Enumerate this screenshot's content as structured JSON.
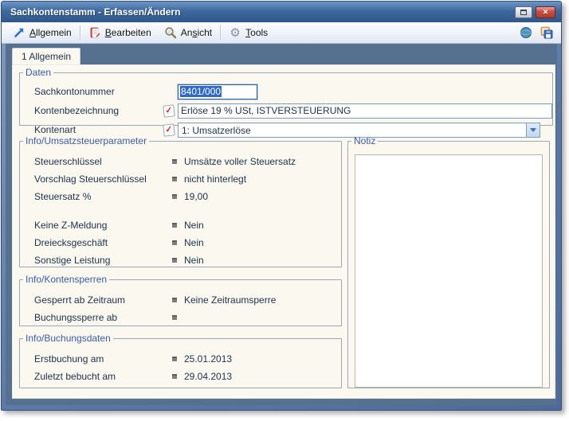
{
  "window": {
    "title": "Sachkontenstamm - Erfassen/Ändern",
    "controls": {
      "restore": "restore-window",
      "close_glyph": "✕"
    }
  },
  "toolbar": {
    "items": [
      {
        "label": "Allgemein",
        "mnemonic": "A",
        "icon": "arrow-up-right-icon"
      },
      {
        "label": "Bearbeiten",
        "mnemonic": "B",
        "icon": "notebook-icon"
      },
      {
        "label": "Ansicht",
        "mnemonic": "s",
        "icon": "magnifier-icon"
      },
      {
        "label": "Tools",
        "mnemonic": "T",
        "icon": "gears-icon"
      }
    ],
    "right_icons": [
      "globe-icon",
      "save-icon"
    ],
    "gear_glyph": "⚙"
  },
  "tab": {
    "label": "1 Allgemein"
  },
  "daten": {
    "legend": "Daten",
    "sachkontonummer": {
      "label": "Sachkontonummer",
      "value": "8401/000"
    },
    "kontenbezeichnung": {
      "label": "Kontenbezeichnung",
      "value": "Erlöse 19 % USt, ISTVERSTEUERUNG"
    },
    "kontenart": {
      "label": "Kontenart",
      "value": "1: Umsatzerlöse"
    },
    "check_glyph": "✓"
  },
  "umsatzsteuer": {
    "legend": "Info/Umsatzsteuerparameter",
    "rows": [
      {
        "label": "Steuerschlüssel",
        "value": "Umsätze voller Steuersatz"
      },
      {
        "label": "Vorschlag Steuerschlüssel",
        "value": "nicht hinterlegt"
      },
      {
        "label": "Steuersatz %",
        "value": "19,00"
      },
      {
        "label": "Keine Z-Meldung",
        "value": "Nein"
      },
      {
        "label": "Dreiecksgeschäft",
        "value": "Nein"
      },
      {
        "label": "Sonstige Leistung",
        "value": "Nein"
      }
    ]
  },
  "kontensperren": {
    "legend": "Info/Kontensperren",
    "rows": [
      {
        "label": "Gesperrt ab Zeitraum",
        "value": "Keine Zeitraumsperre"
      },
      {
        "label": "Buchungssperre ab",
        "value": ""
      }
    ]
  },
  "buchungsdaten": {
    "legend": "Info/Buchungsdaten",
    "rows": [
      {
        "label": "Erstbuchung am",
        "value": "25.01.2013"
      },
      {
        "label": "Zuletzt bebucht am",
        "value": "29.04.2013"
      }
    ]
  },
  "notiz": {
    "legend": "Notiz",
    "value": ""
  },
  "colors": {
    "titlebar_blue": "#3E699E",
    "client_slate": "#56718F",
    "page_cream": "#FAF8EF",
    "legend_blue": "#3A5CA8",
    "selection_blue": "#316AC5",
    "close_red": "#B23A2E"
  }
}
